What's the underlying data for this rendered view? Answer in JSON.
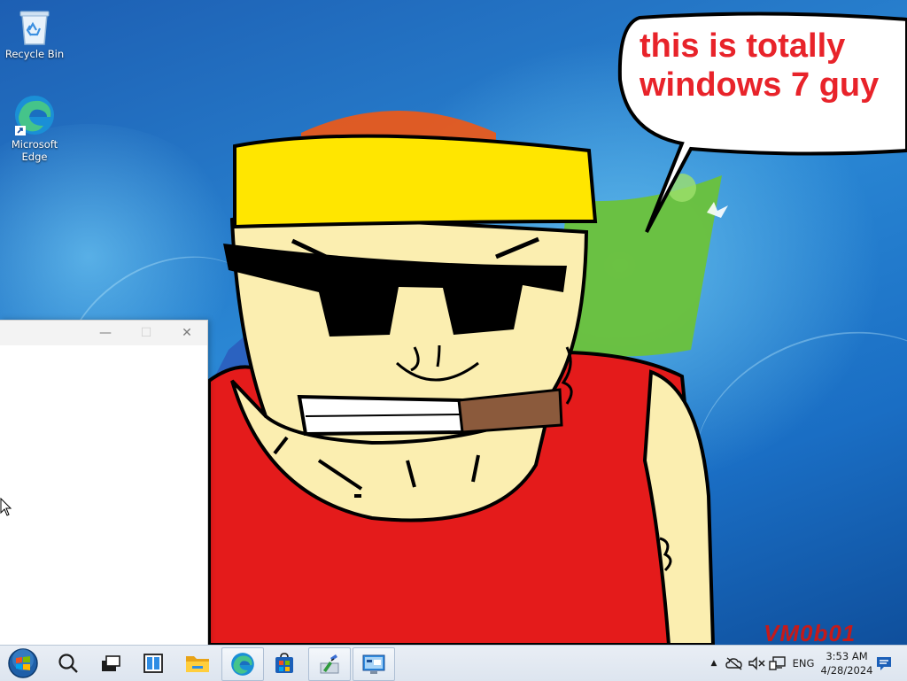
{
  "desktop": {
    "icons": [
      {
        "label": "Recycle Bin",
        "glyph": "recycle-bin-icon"
      },
      {
        "label": "Microsoft\nEdge",
        "glyph": "edge-icon"
      }
    ],
    "wallpaper_colors": {
      "sky": "#2a87d4",
      "shirt": "#e41b1b",
      "headband": "#ffe600",
      "skin": "#fbeeb0",
      "cigar": "#8b5a3c"
    }
  },
  "drawing": {
    "speech_bubble": "this is totally windows 7 guy",
    "signature": "VM0b01"
  },
  "window": {
    "minimize": "—",
    "maximize": "☐",
    "close": "✕"
  },
  "taskbar": {
    "buttons": [
      "start",
      "search",
      "task-view",
      "widgets",
      "file-explorer",
      "edge",
      "store",
      "paint",
      "remote-desktop"
    ],
    "tray": {
      "chevron": "▲",
      "language": "ENG",
      "time": "3:53 AM",
      "date": "4/28/2024"
    }
  }
}
